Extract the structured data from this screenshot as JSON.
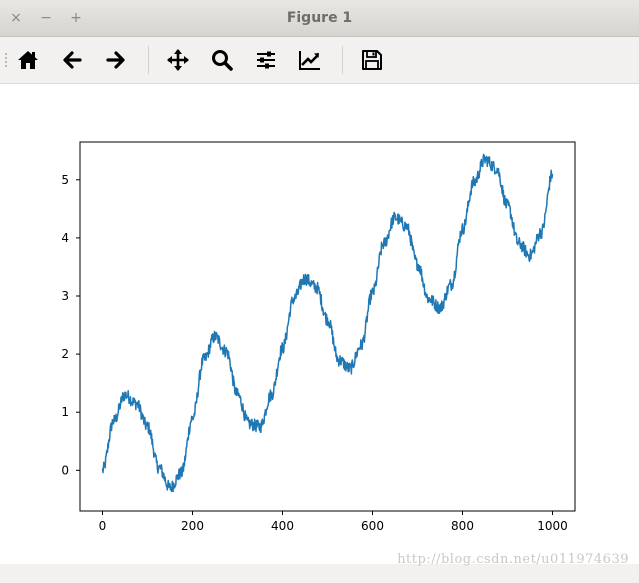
{
  "window": {
    "title": "Figure 1",
    "close_glyph": "×",
    "minimize_glyph": "−",
    "maximize_glyph": "+"
  },
  "toolbar": {
    "buttons": [
      {
        "icon": "home-icon"
      },
      {
        "icon": "back-arrow-icon"
      },
      {
        "icon": "forward-arrow-icon"
      },
      {
        "icon": "pan-icon"
      },
      {
        "icon": "zoom-icon"
      },
      {
        "icon": "subplots-icon"
      },
      {
        "icon": "edit-axis-icon"
      },
      {
        "icon": "save-icon"
      }
    ]
  },
  "watermark": "http://blog.csdn.net/u011974639",
  "chart_data": {
    "type": "line",
    "title": "",
    "xlabel": "",
    "ylabel": "",
    "xlim": [
      -50,
      1050
    ],
    "ylim": [
      -0.7,
      5.65
    ],
    "xticks": [
      0,
      200,
      400,
      600,
      800,
      1000
    ],
    "yticks": [
      0,
      1,
      2,
      3,
      4,
      5
    ],
    "grid": false,
    "line_color": "#1f77b4",
    "series": [
      {
        "x": [
          0,
          25,
          50,
          75,
          100,
          125,
          150,
          175,
          200,
          225,
          250,
          275,
          300,
          325,
          350,
          375,
          400,
          425,
          450,
          475,
          500,
          525,
          550,
          575,
          600,
          625,
          650,
          675,
          700,
          725,
          750,
          775,
          800,
          825,
          850,
          875,
          900,
          925,
          950,
          975,
          1000
        ],
        "values": [
          0.0,
          0.85,
          1.3,
          1.15,
          0.75,
          0.05,
          -0.3,
          -0.05,
          0.9,
          1.9,
          2.3,
          2.05,
          1.3,
          0.8,
          0.75,
          1.3,
          2.1,
          2.95,
          3.3,
          3.15,
          2.6,
          1.9,
          1.75,
          2.15,
          3.05,
          3.9,
          4.35,
          4.2,
          3.55,
          2.95,
          2.8,
          3.2,
          4.15,
          4.95,
          5.35,
          5.2,
          4.55,
          3.9,
          3.7,
          4.1,
          5.1
        ]
      }
    ]
  }
}
